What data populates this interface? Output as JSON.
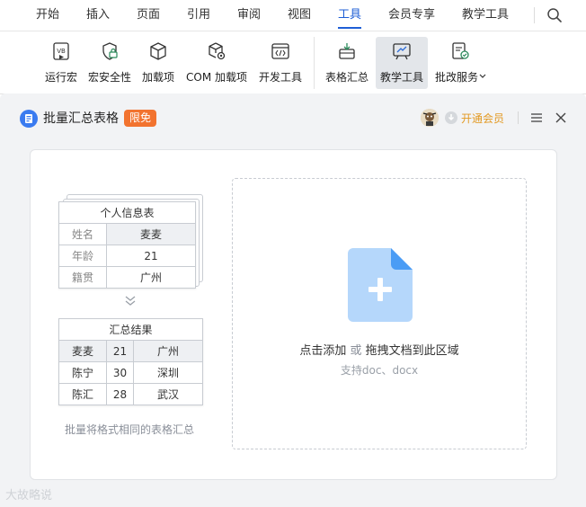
{
  "menubar": {
    "items": [
      {
        "label": "开始"
      },
      {
        "label": "插入"
      },
      {
        "label": "页面"
      },
      {
        "label": "引用"
      },
      {
        "label": "审阅"
      },
      {
        "label": "视图"
      },
      {
        "label": "工具",
        "active": true
      },
      {
        "label": "会员专享"
      },
      {
        "label": "教学工具"
      }
    ],
    "search_icon": "search-icon"
  },
  "ribbon": {
    "tools": [
      {
        "label": "运行宏",
        "icon": "vb-macro-icon"
      },
      {
        "label": "宏安全性",
        "icon": "shield-lock-icon"
      },
      {
        "label": "加载项",
        "icon": "cube-icon"
      },
      {
        "label": "COM 加载项",
        "icon": "cube-gear-icon"
      },
      {
        "label": "开发工具",
        "icon": "code-window-icon"
      },
      {
        "label": "表格汇总",
        "icon": "table-summary-icon"
      },
      {
        "label": "教学工具",
        "icon": "teaching-board-icon",
        "selected": true
      },
      {
        "label": "批改服务",
        "icon": "grading-icon",
        "dropdown": true
      }
    ]
  },
  "panel": {
    "title": "批量汇总表格",
    "badge": "限免",
    "vip_label": "开通会员",
    "colors": {
      "accent": "#3a7bf0",
      "badge": "#f2732f",
      "vip": "#e39a24"
    }
  },
  "illustration": {
    "info_table": {
      "title": "个人信息表",
      "rows": [
        {
          "label": "姓名",
          "value": "麦麦"
        },
        {
          "label": "年龄",
          "value": "21"
        },
        {
          "label": "籍贯",
          "value": "广州"
        }
      ]
    },
    "result_table": {
      "title": "汇总结果",
      "rows": [
        [
          "麦麦",
          "21",
          "广州"
        ],
        [
          "陈宁",
          "30",
          "深圳"
        ],
        [
          "陈汇",
          "28",
          "武汉"
        ]
      ]
    },
    "caption": "批量将格式相同的表格汇总"
  },
  "dropzone": {
    "main_text_1": "点击添加",
    "or_text": "或",
    "main_text_2": "拖拽文档到此区域",
    "sub_text": "支持doc、docx"
  },
  "watermark": "大故略说"
}
